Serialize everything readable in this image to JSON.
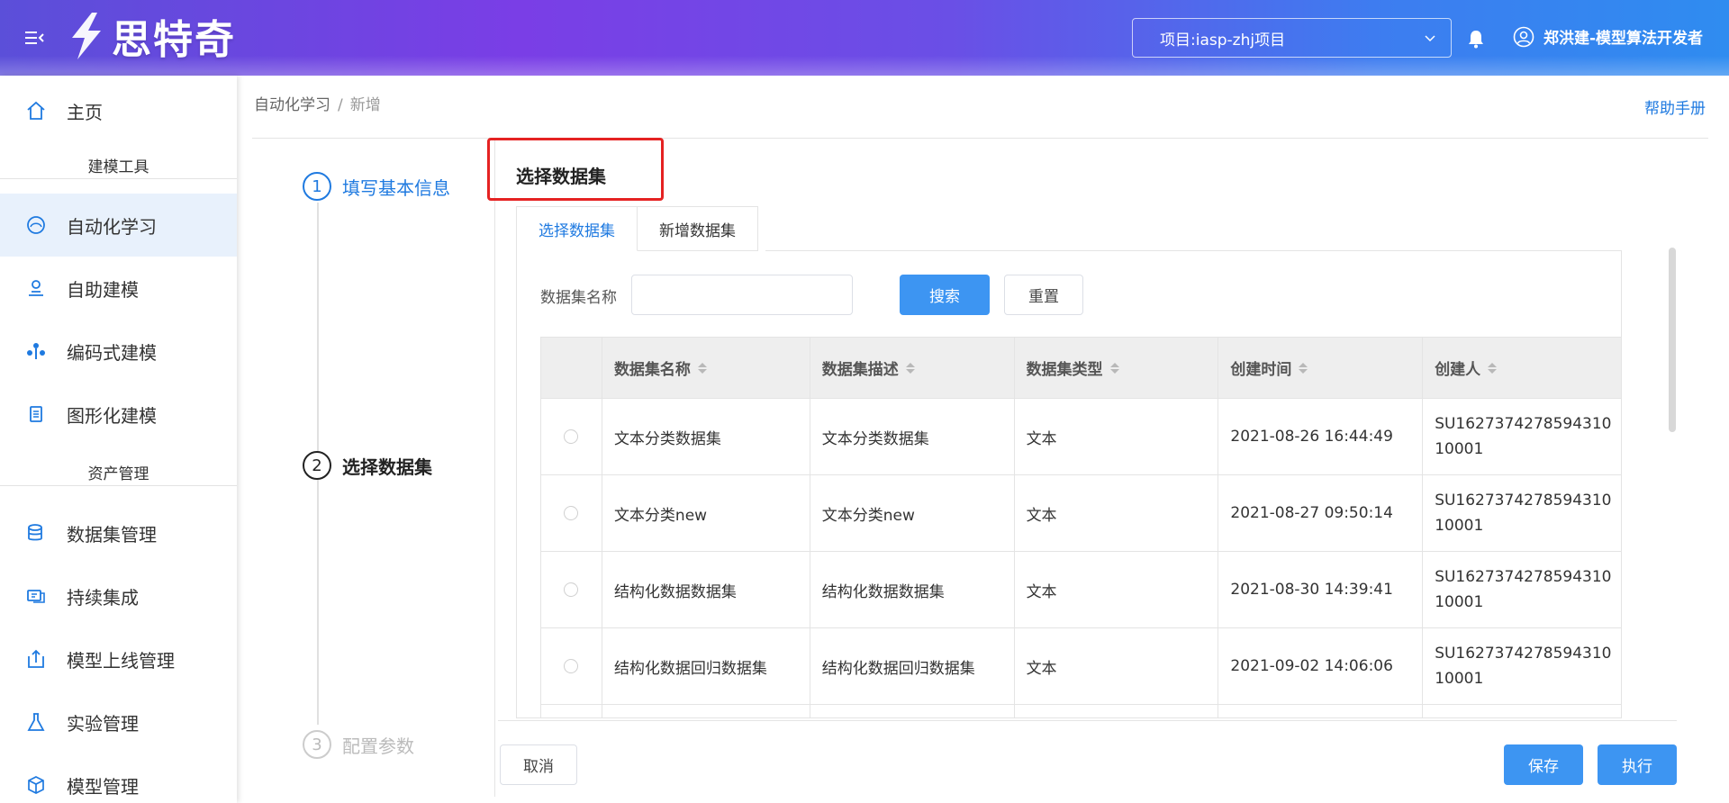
{
  "header": {
    "logo_text": "思特奇",
    "project_label": "项目:iasp-zhj项目",
    "user_name": "郑洪建-模型算法开发者"
  },
  "sidebar": {
    "home": "主页",
    "group_modeling": "建模工具",
    "automl": "自动化学习",
    "self_modeling": "自助建模",
    "code_modeling": "编码式建模",
    "graph_modeling": "图形化建模",
    "group_assets": "资产管理",
    "dataset_mgmt": "数据集管理",
    "ci": "持续集成",
    "model_online": "模型上线管理",
    "experiment": "实验管理",
    "model_mgmt": "模型管理"
  },
  "breadcrumb": {
    "parent": "自动化学习",
    "separator": "/",
    "current": "新增"
  },
  "help_link": "帮助手册",
  "steps": [
    {
      "num": "1",
      "label": "填写基本信息"
    },
    {
      "num": "2",
      "label": "选择数据集"
    },
    {
      "num": "3",
      "label": "配置参数"
    }
  ],
  "section_title": "选择数据集",
  "tabs": [
    "选择数据集",
    "新增数据集"
  ],
  "search": {
    "label": "数据集名称",
    "placeholder": "",
    "search_button": "搜索",
    "reset_button": "重置"
  },
  "table": {
    "columns": [
      "数据集名称",
      "数据集描述",
      "数据集类型",
      "创建时间",
      "创建人"
    ],
    "rows": [
      {
        "name": "文本分类数据集",
        "desc": "文本分类数据集",
        "type": "文本",
        "time": "2021-08-26 16:44:49",
        "creator": "SU162737427859431010001"
      },
      {
        "name": "文本分类new",
        "desc": "文本分类new",
        "type": "文本",
        "time": "2021-08-27 09:50:14",
        "creator": "SU162737427859431010001"
      },
      {
        "name": "结构化数据数据集",
        "desc": "结构化数据数据集",
        "type": "文本",
        "time": "2021-08-30 14:39:41",
        "creator": "SU162737427859431010001"
      },
      {
        "name": "结构化数据回归数据集",
        "desc": "结构化数据回归数据集",
        "type": "文本",
        "time": "2021-09-02 14:06:06",
        "creator": "SU162737427859431010001"
      }
    ]
  },
  "footer": {
    "cancel": "取消",
    "save": "保存",
    "execute": "执行"
  },
  "colors": {
    "accent": "#1f7ae0",
    "primary_button": "#3d95f2",
    "highlight": "#e52222"
  }
}
